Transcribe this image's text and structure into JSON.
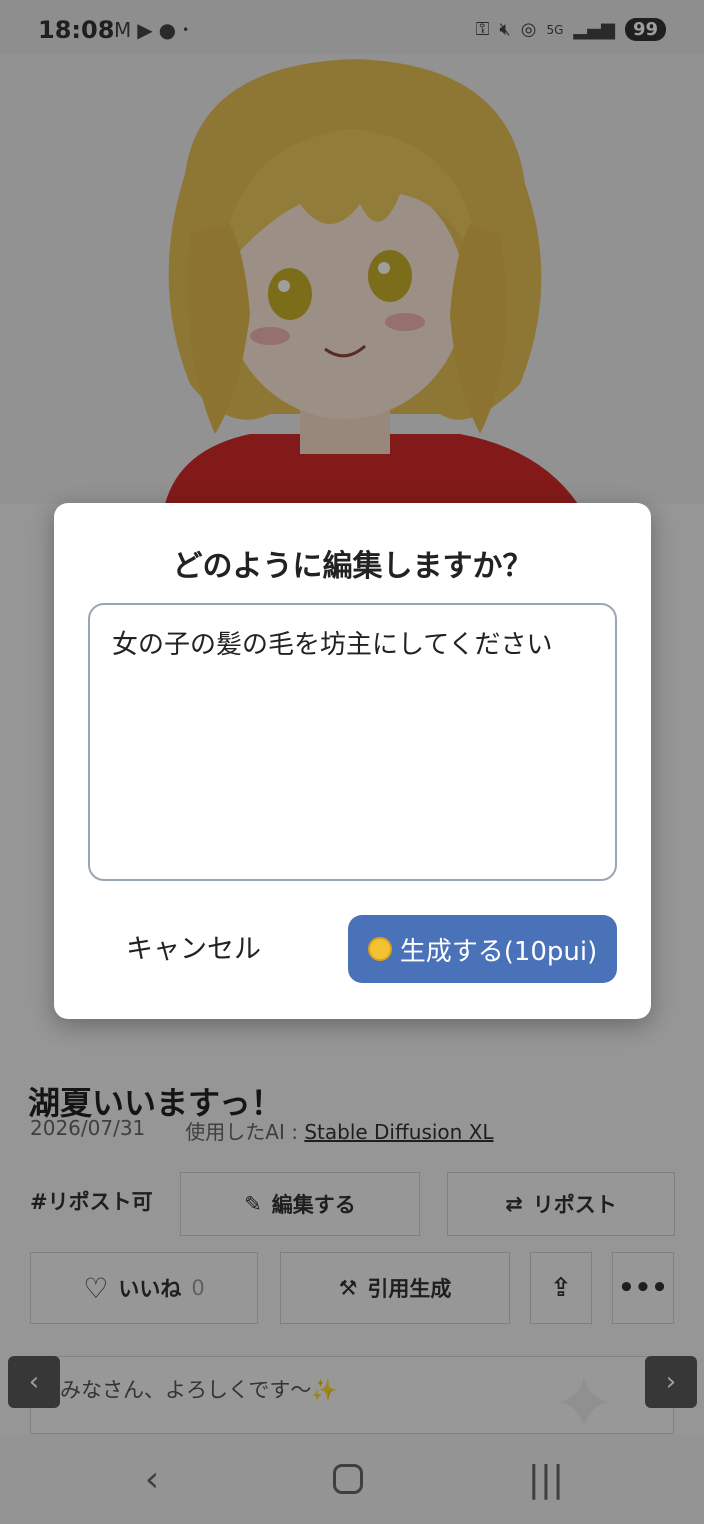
{
  "status_bar": {
    "time": "18:08",
    "left_icons": [
      "gmail-icon",
      "youtube-icon",
      "app-icon",
      "dot-icon"
    ],
    "network": "5G",
    "battery": "99"
  },
  "post": {
    "title": "湖夏いいますっ！",
    "date": "2026/07/31",
    "ai_label": "使用したAI : ",
    "ai_name": "Stable Diffusion XL",
    "repost_ok": "#リポスト可",
    "edit_label": "編集する",
    "repost_label": "リポスト",
    "like_label": "いいね",
    "like_count": "0",
    "quote_label": "引用生成",
    "comment": "みなさん、よろしくです〜✨"
  },
  "dialog": {
    "title": "どのように編集しますか？",
    "input_value": "女の子の髪の毛を坊主にしてください",
    "cancel_label": "キャンセル",
    "generate_label": "生成する(10pui)"
  },
  "colors": {
    "accent": "#4a72b8",
    "coin": "#f2c230",
    "shirt": "#d42a2a",
    "hair": "#e8c45a"
  }
}
